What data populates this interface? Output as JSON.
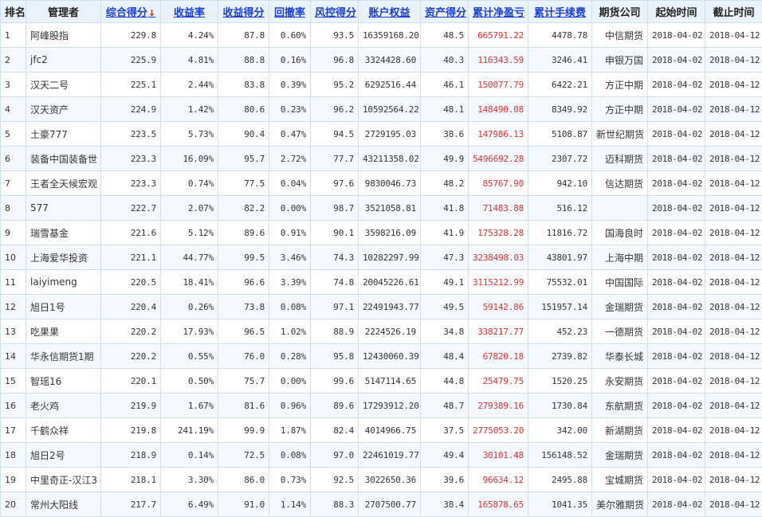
{
  "headers": {
    "rank": "排名",
    "manager": "管理者",
    "score": "综合得分",
    "score_sort_arrow": "↓",
    "return_rate": "收益率",
    "return_score": "收益得分",
    "drawdown": "回撤率",
    "risk_score": "风控得分",
    "equity": "账户权益",
    "asset_score": "资产得分",
    "net_profit": "累计净盈亏",
    "fees": "累计手续费",
    "futures_co": "期货公司",
    "start": "起始时间",
    "end": "截止时间"
  },
  "rows": [
    {
      "rank": "1",
      "manager": "阿峰股指",
      "score": "229.8",
      "return_rate": "4.24%",
      "return_score": "87.8",
      "drawdown": "0.60%",
      "risk_score": "93.5",
      "equity": "16359168.20",
      "asset_score": "48.5",
      "net_profit": "665791.22",
      "fees": "4478.78",
      "futures_co": "中信期货",
      "start": "2018-04-02",
      "end": "2018-04-12"
    },
    {
      "rank": "2",
      "manager": "jfc2",
      "score": "225.9",
      "return_rate": "4.81%",
      "return_score": "88.8",
      "drawdown": "0.16%",
      "risk_score": "96.8",
      "equity": "3324428.60",
      "asset_score": "40.3",
      "net_profit": "116343.59",
      "fees": "3246.41",
      "futures_co": "申银万国",
      "start": "2018-04-02",
      "end": "2018-04-12"
    },
    {
      "rank": "3",
      "manager": "汉天二号",
      "score": "225.1",
      "return_rate": "2.44%",
      "return_score": "83.8",
      "drawdown": "0.39%",
      "risk_score": "95.2",
      "equity": "6292516.44",
      "asset_score": "46.1",
      "net_profit": "150077.79",
      "fees": "6422.21",
      "futures_co": "方正中期",
      "start": "2018-04-02",
      "end": "2018-04-12"
    },
    {
      "rank": "4",
      "manager": "汉天资产",
      "score": "224.9",
      "return_rate": "1.42%",
      "return_score": "80.6",
      "drawdown": "0.23%",
      "risk_score": "96.2",
      "equity": "10592564.22",
      "asset_score": "48.1",
      "net_profit": "148490.08",
      "fees": "8349.92",
      "futures_co": "方正中期",
      "start": "2018-04-02",
      "end": "2018-04-12"
    },
    {
      "rank": "5",
      "manager": "土豪777",
      "score": "223.5",
      "return_rate": "5.73%",
      "return_score": "90.4",
      "drawdown": "0.47%",
      "risk_score": "94.5",
      "equity": "2729195.03",
      "asset_score": "38.6",
      "net_profit": "147986.13",
      "fees": "5108.87",
      "futures_co": "新世纪期货",
      "start": "2018-04-02",
      "end": "2018-04-12"
    },
    {
      "rank": "6",
      "manager": "装备中国装备世",
      "score": "223.3",
      "return_rate": "16.09%",
      "return_score": "95.7",
      "drawdown": "2.72%",
      "risk_score": "77.7",
      "equity": "43211358.02",
      "asset_score": "49.9",
      "net_profit": "5496692.28",
      "fees": "2307.72",
      "futures_co": "迈科期货",
      "start": "2018-04-02",
      "end": "2018-04-12"
    },
    {
      "rank": "7",
      "manager": "王者全天候宏观",
      "score": "223.3",
      "return_rate": "0.74%",
      "return_score": "77.5",
      "drawdown": "0.04%",
      "risk_score": "97.6",
      "equity": "9830046.73",
      "asset_score": "48.2",
      "net_profit": "85767.90",
      "fees": "942.10",
      "futures_co": "信达期货",
      "start": "2018-04-02",
      "end": "2018-04-12"
    },
    {
      "rank": "8",
      "manager": "577",
      "score": "222.7",
      "return_rate": "2.07%",
      "return_score": "82.2",
      "drawdown": "0.00%",
      "risk_score": "98.7",
      "equity": "3521058.81",
      "asset_score": "41.8",
      "net_profit": "71483.88",
      "fees": "516.12",
      "futures_co": "",
      "start": "2018-04-02",
      "end": "2018-04-12"
    },
    {
      "rank": "9",
      "manager": "瑞雪基金",
      "score": "221.6",
      "return_rate": "5.12%",
      "return_score": "89.6",
      "drawdown": "0.91%",
      "risk_score": "90.1",
      "equity": "3598216.09",
      "asset_score": "41.9",
      "net_profit": "175328.28",
      "fees": "11816.72",
      "futures_co": "国海良时",
      "start": "2018-04-02",
      "end": "2018-04-12"
    },
    {
      "rank": "10",
      "manager": "上海爱华投资",
      "score": "221.1",
      "return_rate": "44.77%",
      "return_score": "99.5",
      "drawdown": "3.46%",
      "risk_score": "74.3",
      "equity": "10282297.99",
      "asset_score": "47.3",
      "net_profit": "3238498.03",
      "fees": "43801.97",
      "futures_co": "上海中期",
      "start": "2018-04-02",
      "end": "2018-04-12"
    },
    {
      "rank": "11",
      "manager": "laiyimeng",
      "score": "220.5",
      "return_rate": "18.41%",
      "return_score": "96.6",
      "drawdown": "3.39%",
      "risk_score": "74.8",
      "equity": "20045226.61",
      "asset_score": "49.1",
      "net_profit": "3115212.99",
      "fees": "75532.01",
      "futures_co": "中国国际",
      "start": "2018-04-02",
      "end": "2018-04-12"
    },
    {
      "rank": "12",
      "manager": "旭日1号",
      "score": "220.4",
      "return_rate": "0.26%",
      "return_score": "73.8",
      "drawdown": "0.08%",
      "risk_score": "97.1",
      "equity": "22491943.77",
      "asset_score": "49.5",
      "net_profit": "59142.86",
      "fees": "151957.14",
      "futures_co": "金瑞期货",
      "start": "2018-04-02",
      "end": "2018-04-12"
    },
    {
      "rank": "13",
      "manager": "吃果果",
      "score": "220.2",
      "return_rate": "17.93%",
      "return_score": "96.5",
      "drawdown": "1.02%",
      "risk_score": "88.9",
      "equity": "2224526.19",
      "asset_score": "34.8",
      "net_profit": "338217.77",
      "fees": "452.23",
      "futures_co": "一德期货",
      "start": "2018-04-02",
      "end": "2018-04-12"
    },
    {
      "rank": "14",
      "manager": "华永信期货1期",
      "score": "220.2",
      "return_rate": "0.55%",
      "return_score": "76.0",
      "drawdown": "0.28%",
      "risk_score": "95.8",
      "equity": "12430060.39",
      "asset_score": "48.4",
      "net_profit": "67820.18",
      "fees": "2739.82",
      "futures_co": "华泰长城",
      "start": "2018-04-02",
      "end": "2018-04-12"
    },
    {
      "rank": "15",
      "manager": "智瑶16",
      "score": "220.1",
      "return_rate": "0.50%",
      "return_score": "75.7",
      "drawdown": "0.00%",
      "risk_score": "99.6",
      "equity": "5147114.65",
      "asset_score": "44.8",
      "net_profit": "25479.75",
      "fees": "1520.25",
      "futures_co": "永安期货",
      "start": "2018-04-02",
      "end": "2018-04-12"
    },
    {
      "rank": "16",
      "manager": "老火鸡",
      "score": "219.9",
      "return_rate": "1.67%",
      "return_score": "81.6",
      "drawdown": "0.96%",
      "risk_score": "89.6",
      "equity": "17293912.20",
      "asset_score": "48.7",
      "net_profit": "279389.16",
      "fees": "1730.84",
      "futures_co": "东航期货",
      "start": "2018-04-02",
      "end": "2018-04-12"
    },
    {
      "rank": "17",
      "manager": "千鹤众祥",
      "score": "219.8",
      "return_rate": "241.19%",
      "return_score": "99.9",
      "drawdown": "1.87%",
      "risk_score": "82.4",
      "equity": "4014966.75",
      "asset_score": "37.5",
      "net_profit": "2775053.20",
      "fees": "342.00",
      "futures_co": "新湖期货",
      "start": "2018-04-02",
      "end": "2018-04-12"
    },
    {
      "rank": "18",
      "manager": "旭日2号",
      "score": "218.9",
      "return_rate": "0.14%",
      "return_score": "72.5",
      "drawdown": "0.08%",
      "risk_score": "97.0",
      "equity": "22461019.77",
      "asset_score": "49.4",
      "net_profit": "30101.48",
      "fees": "156148.52",
      "futures_co": "金瑞期货",
      "start": "2018-04-02",
      "end": "2018-04-12"
    },
    {
      "rank": "19",
      "manager": "中里奇正-汉江3",
      "score": "218.1",
      "return_rate": "3.30%",
      "return_score": "86.0",
      "drawdown": "0.73%",
      "risk_score": "92.5",
      "equity": "3022650.36",
      "asset_score": "39.6",
      "net_profit": "96634.12",
      "fees": "2495.88",
      "futures_co": "宝城期货",
      "start": "2018-04-02",
      "end": "2018-04-12"
    },
    {
      "rank": "20",
      "manager": "常州大阳线",
      "score": "217.7",
      "return_rate": "6.49%",
      "return_score": "91.0",
      "drawdown": "1.14%",
      "risk_score": "88.3",
      "equity": "2707500.77",
      "asset_score": "38.4",
      "net_profit": "165878.65",
      "fees": "1041.35",
      "futures_co": "美尔雅期货",
      "start": "2018-04-02",
      "end": "2018-04-12"
    }
  ]
}
